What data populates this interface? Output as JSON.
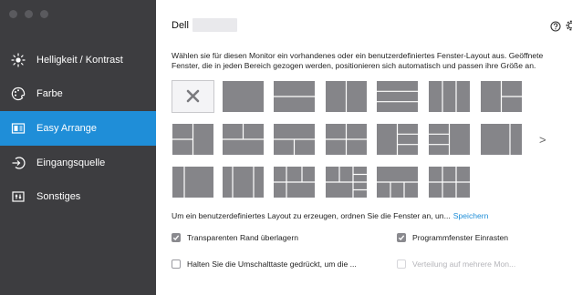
{
  "sidebar": {
    "items": [
      {
        "label": "Helligkeit / Kontrast",
        "icon": "brightness-icon",
        "active": false
      },
      {
        "label": "Farbe",
        "icon": "color-icon",
        "active": false
      },
      {
        "label": "Easy Arrange",
        "icon": "easy-arrange-icon",
        "active": true
      },
      {
        "label": "Eingangsquelle",
        "icon": "input-source-icon",
        "active": false
      },
      {
        "label": "Sonstiges",
        "icon": "misc-icon",
        "active": false
      }
    ]
  },
  "header": {
    "brand": "Dell",
    "help_icon": "help-icon",
    "settings_icon": "gear-icon"
  },
  "main": {
    "description": "Wählen sie für diesen Monitor ein vorhandenes oder ein benutzerdefiniertes Fenster-Layout aus.  Geöffnete Fenster, die in jeden Bereich gezogen werden, positionieren sich automatisch und passen ihre Größe an.",
    "next_arrow": ">",
    "instruction": "Um ein benutzerdefiniertes Layout zu erzeugen, ordnen Sie die Fenster an, un...",
    "save_link": "Speichern",
    "options": [
      {
        "label": "Transparenten Rand überlagern",
        "checked": true,
        "disabled": false
      },
      {
        "label": "Programmfenster Einrasten",
        "checked": true,
        "disabled": false
      },
      {
        "label": "Halten Sie die Umschalttaste gedrückt, um die ...",
        "checked": false,
        "disabled": false
      },
      {
        "label": "Verteilung auf mehrere Mon...",
        "checked": false,
        "disabled": true
      }
    ]
  },
  "colors": {
    "sidebar_bg": "#3d3d40",
    "accent": "#1f8ed8",
    "tile_fill": "#858589"
  }
}
